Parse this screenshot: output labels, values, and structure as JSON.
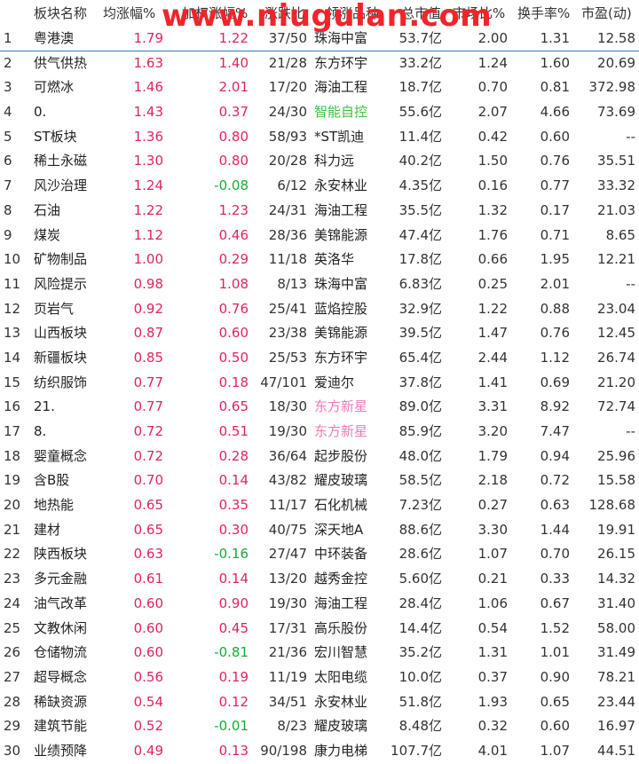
{
  "headers": {
    "name": "板块名称",
    "avg_change": "均涨幅%",
    "weighted_change": "加权涨幅%",
    "up_ratio": "涨跌比",
    "leader": "领涨品种",
    "market_cap": "总市值",
    "up_percent": "市场比%",
    "turnover": "换手率%",
    "pe": "市盈(动)"
  },
  "watermark": "www.niugulan.com",
  "colors": {
    "up": "#e0245e",
    "down": "#19a93a",
    "selection": "#3a78c2"
  },
  "rows": [
    {
      "idx": "1",
      "name": "粤港澳",
      "avg": "1.79",
      "wavg": "1.22",
      "ratio": "37/50",
      "leader": "珠海中富",
      "mcap": "53.7亿",
      "up": "2.00",
      "turn": "1.31",
      "pe": "12.58",
      "wdir": "red",
      "lcolor": ""
    },
    {
      "idx": "2",
      "name": "供气供热",
      "avg": "1.63",
      "wavg": "1.40",
      "ratio": "21/28",
      "leader": "东方环宇",
      "mcap": "33.2亿",
      "up": "1.24",
      "turn": "1.60",
      "pe": "20.69",
      "wdir": "red",
      "lcolor": ""
    },
    {
      "idx": "3",
      "name": "可燃冰",
      "avg": "1.46",
      "wavg": "2.01",
      "ratio": "17/20",
      "leader": "海油工程",
      "mcap": "18.7亿",
      "up": "0.70",
      "turn": "0.81",
      "pe": "372.98",
      "wdir": "red",
      "lcolor": ""
    },
    {
      "idx": "4",
      "name": "0.",
      "avg": "1.43",
      "wavg": "0.37",
      "ratio": "24/30",
      "leader": "智能自控",
      "mcap": "55.6亿",
      "up": "2.07",
      "turn": "4.66",
      "pe": "73.69",
      "wdir": "red",
      "lcolor": "lgreen"
    },
    {
      "idx": "5",
      "name": "ST板块",
      "avg": "1.36",
      "wavg": "0.80",
      "ratio": "58/93",
      "leader": "*ST凯迪",
      "mcap": "11.4亿",
      "up": "0.42",
      "turn": "0.60",
      "pe": "--",
      "wdir": "red",
      "lcolor": ""
    },
    {
      "idx": "6",
      "name": "稀土永磁",
      "avg": "1.30",
      "wavg": "0.80",
      "ratio": "20/28",
      "leader": "科力远",
      "mcap": "40.2亿",
      "up": "1.50",
      "turn": "0.76",
      "pe": "35.51",
      "wdir": "red",
      "lcolor": ""
    },
    {
      "idx": "7",
      "name": "风沙治理",
      "avg": "1.24",
      "wavg": "-0.08",
      "ratio": "6/12",
      "leader": "永安林业",
      "mcap": "4.35亿",
      "up": "0.16",
      "turn": "0.77",
      "pe": "33.32",
      "wdir": "green",
      "lcolor": ""
    },
    {
      "idx": "8",
      "name": "石油",
      "avg": "1.22",
      "wavg": "1.23",
      "ratio": "24/31",
      "leader": "海油工程",
      "mcap": "35.5亿",
      "up": "1.32",
      "turn": "0.17",
      "pe": "21.03",
      "wdir": "red",
      "lcolor": ""
    },
    {
      "idx": "9",
      "name": "煤炭",
      "avg": "1.12",
      "wavg": "0.46",
      "ratio": "28/36",
      "leader": "美锦能源",
      "mcap": "47.4亿",
      "up": "1.76",
      "turn": "0.71",
      "pe": "8.65",
      "wdir": "red",
      "lcolor": ""
    },
    {
      "idx": "10",
      "name": "矿物制品",
      "avg": "1.00",
      "wavg": "0.29",
      "ratio": "11/18",
      "leader": "英洛华",
      "mcap": "17.8亿",
      "up": "0.66",
      "turn": "1.95",
      "pe": "12.21",
      "wdir": "red",
      "lcolor": ""
    },
    {
      "idx": "11",
      "name": "风险提示",
      "avg": "0.98",
      "wavg": "1.08",
      "ratio": "8/13",
      "leader": "珠海中富",
      "mcap": "6.83亿",
      "up": "0.25",
      "turn": "2.01",
      "pe": "--",
      "wdir": "red",
      "lcolor": ""
    },
    {
      "idx": "12",
      "name": "页岩气",
      "avg": "0.92",
      "wavg": "0.76",
      "ratio": "25/41",
      "leader": "蓝焰控股",
      "mcap": "32.9亿",
      "up": "1.22",
      "turn": "0.88",
      "pe": "23.04",
      "wdir": "red",
      "lcolor": ""
    },
    {
      "idx": "13",
      "name": "山西板块",
      "avg": "0.87",
      "wavg": "0.60",
      "ratio": "23/38",
      "leader": "美锦能源",
      "mcap": "39.5亿",
      "up": "1.47",
      "turn": "0.76",
      "pe": "12.45",
      "wdir": "red",
      "lcolor": ""
    },
    {
      "idx": "14",
      "name": "新疆板块",
      "avg": "0.85",
      "wavg": "0.50",
      "ratio": "25/53",
      "leader": "东方环宇",
      "mcap": "65.4亿",
      "up": "2.44",
      "turn": "1.12",
      "pe": "26.74",
      "wdir": "red",
      "lcolor": ""
    },
    {
      "idx": "15",
      "name": "纺织服饰",
      "avg": "0.77",
      "wavg": "0.18",
      "ratio": "47/101",
      "leader": "爱迪尔",
      "mcap": "37.8亿",
      "up": "1.41",
      "turn": "0.69",
      "pe": "21.20",
      "wdir": "red",
      "lcolor": ""
    },
    {
      "idx": "16",
      "name": "21.",
      "avg": "0.77",
      "wavg": "0.65",
      "ratio": "18/30",
      "leader": "东方新星",
      "mcap": "89.0亿",
      "up": "3.31",
      "turn": "8.92",
      "pe": "72.74",
      "wdir": "red",
      "lcolor": "pink"
    },
    {
      "idx": "17",
      "name": "8.",
      "avg": "0.72",
      "wavg": "0.51",
      "ratio": "19/30",
      "leader": "东方新星",
      "mcap": "85.9亿",
      "up": "3.20",
      "turn": "7.47",
      "pe": "--",
      "wdir": "red",
      "lcolor": "pink"
    },
    {
      "idx": "18",
      "name": "婴童概念",
      "avg": "0.72",
      "wavg": "0.28",
      "ratio": "36/64",
      "leader": "起步股份",
      "mcap": "48.0亿",
      "up": "1.79",
      "turn": "0.94",
      "pe": "25.96",
      "wdir": "red",
      "lcolor": ""
    },
    {
      "idx": "19",
      "name": "含B股",
      "avg": "0.70",
      "wavg": "0.14",
      "ratio": "43/82",
      "leader": "耀皮玻璃",
      "mcap": "58.5亿",
      "up": "2.18",
      "turn": "0.72",
      "pe": "15.58",
      "wdir": "red",
      "lcolor": ""
    },
    {
      "idx": "20",
      "name": "地热能",
      "avg": "0.65",
      "wavg": "0.35",
      "ratio": "11/17",
      "leader": "石化机械",
      "mcap": "7.23亿",
      "up": "0.27",
      "turn": "0.63",
      "pe": "128.68",
      "wdir": "red",
      "lcolor": ""
    },
    {
      "idx": "21",
      "name": "建材",
      "avg": "0.65",
      "wavg": "0.30",
      "ratio": "40/75",
      "leader": "深天地A",
      "mcap": "88.6亿",
      "up": "3.30",
      "turn": "1.44",
      "pe": "19.91",
      "wdir": "red",
      "lcolor": ""
    },
    {
      "idx": "22",
      "name": "陕西板块",
      "avg": "0.63",
      "wavg": "-0.16",
      "ratio": "27/47",
      "leader": "中环装备",
      "mcap": "28.6亿",
      "up": "1.07",
      "turn": "0.70",
      "pe": "26.15",
      "wdir": "green",
      "lcolor": ""
    },
    {
      "idx": "23",
      "name": "多元金融",
      "avg": "0.61",
      "wavg": "0.14",
      "ratio": "13/20",
      "leader": "越秀金控",
      "mcap": "5.60亿",
      "up": "0.21",
      "turn": "0.33",
      "pe": "14.32",
      "wdir": "red",
      "lcolor": ""
    },
    {
      "idx": "24",
      "name": "油气改革",
      "avg": "0.60",
      "wavg": "0.90",
      "ratio": "19/30",
      "leader": "海油工程",
      "mcap": "28.4亿",
      "up": "1.06",
      "turn": "0.67",
      "pe": "31.40",
      "wdir": "red",
      "lcolor": ""
    },
    {
      "idx": "25",
      "name": "文教休闲",
      "avg": "0.60",
      "wavg": "0.45",
      "ratio": "17/31",
      "leader": "高乐股份",
      "mcap": "14.4亿",
      "up": "0.54",
      "turn": "1.52",
      "pe": "58.00",
      "wdir": "red",
      "lcolor": ""
    },
    {
      "idx": "26",
      "name": "仓储物流",
      "avg": "0.60",
      "wavg": "-0.81",
      "ratio": "21/36",
      "leader": "宏川智慧",
      "mcap": "35.2亿",
      "up": "1.31",
      "turn": "1.01",
      "pe": "31.49",
      "wdir": "green",
      "lcolor": ""
    },
    {
      "idx": "27",
      "name": "超导概念",
      "avg": "0.56",
      "wavg": "0.19",
      "ratio": "11/19",
      "leader": "太阳电缆",
      "mcap": "10.0亿",
      "up": "0.37",
      "turn": "0.90",
      "pe": "78.21",
      "wdir": "red",
      "lcolor": ""
    },
    {
      "idx": "28",
      "name": "稀缺资源",
      "avg": "0.54",
      "wavg": "0.12",
      "ratio": "34/51",
      "leader": "永安林业",
      "mcap": "51.8亿",
      "up": "1.93",
      "turn": "0.65",
      "pe": "23.44",
      "wdir": "red",
      "lcolor": ""
    },
    {
      "idx": "29",
      "name": "建筑节能",
      "avg": "0.52",
      "wavg": "-0.01",
      "ratio": "8/23",
      "leader": "耀皮玻璃",
      "mcap": "8.48亿",
      "up": "0.32",
      "turn": "0.60",
      "pe": "16.97",
      "wdir": "green",
      "lcolor": ""
    },
    {
      "idx": "30",
      "name": "业绩预降",
      "avg": "0.49",
      "wavg": "0.13",
      "ratio": "90/198",
      "leader": "康力电梯",
      "mcap": "107.7亿",
      "up": "4.01",
      "turn": "1.07",
      "pe": "44.51",
      "wdir": "red",
      "lcolor": ""
    }
  ]
}
